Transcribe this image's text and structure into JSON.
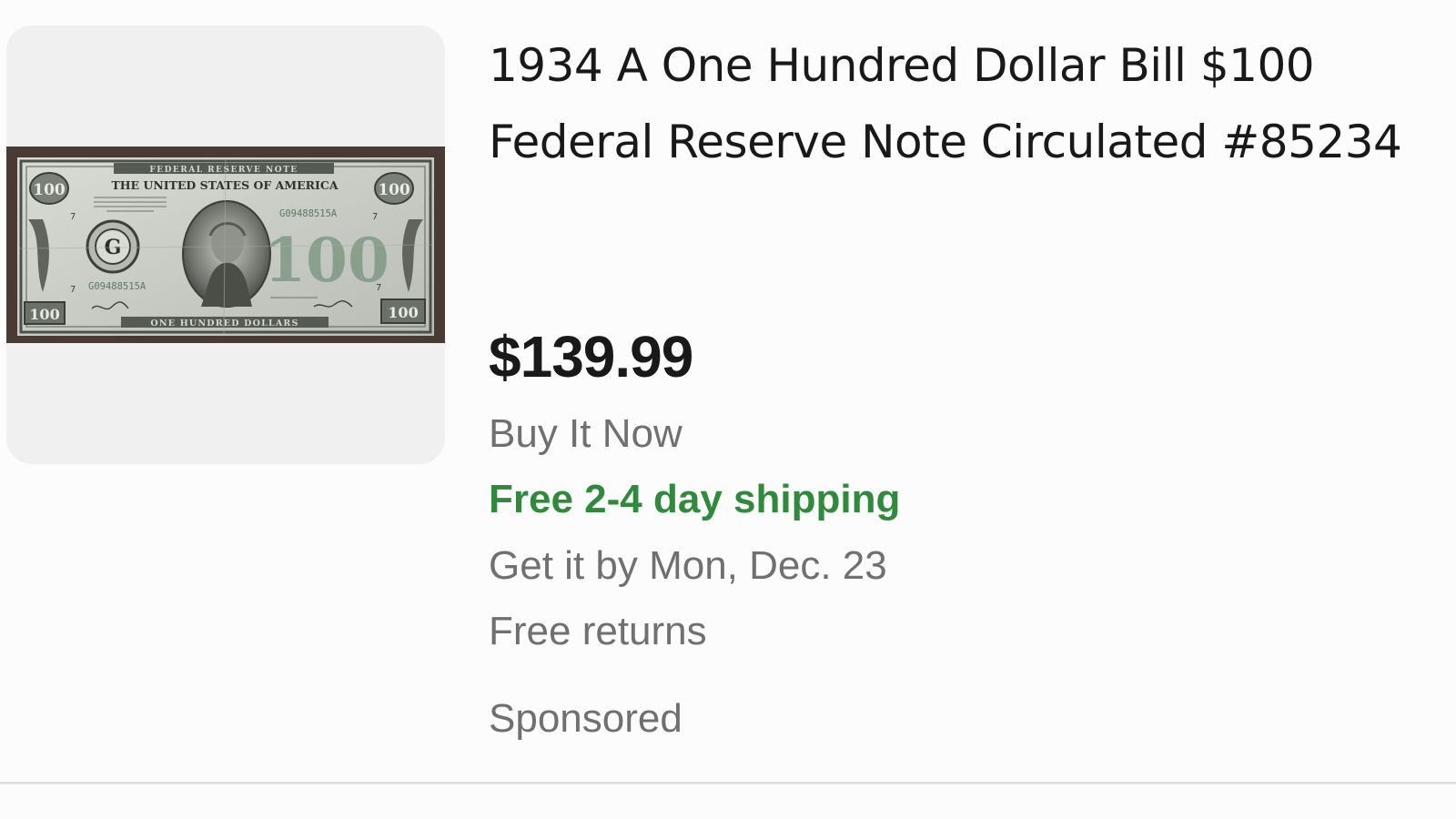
{
  "listing": {
    "image_alt": "1934 A $100 Federal Reserve Note",
    "title": "1934 A One Hundred Dollar Bill $100 Federal Reserve Note Circulated #85234",
    "price": "$139.99",
    "buying_format": "Buy It Now",
    "shipping": "Free 2-4 day shipping",
    "delivery": "Get it by Mon, Dec. 23",
    "returns": "Free returns",
    "sponsored_label": "Sponsored",
    "shipping_color": "#2f8a3b"
  },
  "banknote": {
    "top_banner": "FEDERAL RESERVE NOTE",
    "header": "THE UNITED STATES OF AMERICA",
    "serial": "G09488515A",
    "district_letter": "G",
    "district_number": "7",
    "corner_value": "100",
    "center_value": "100",
    "bottom_banner": "ONE HUNDRED DOLLARS"
  }
}
